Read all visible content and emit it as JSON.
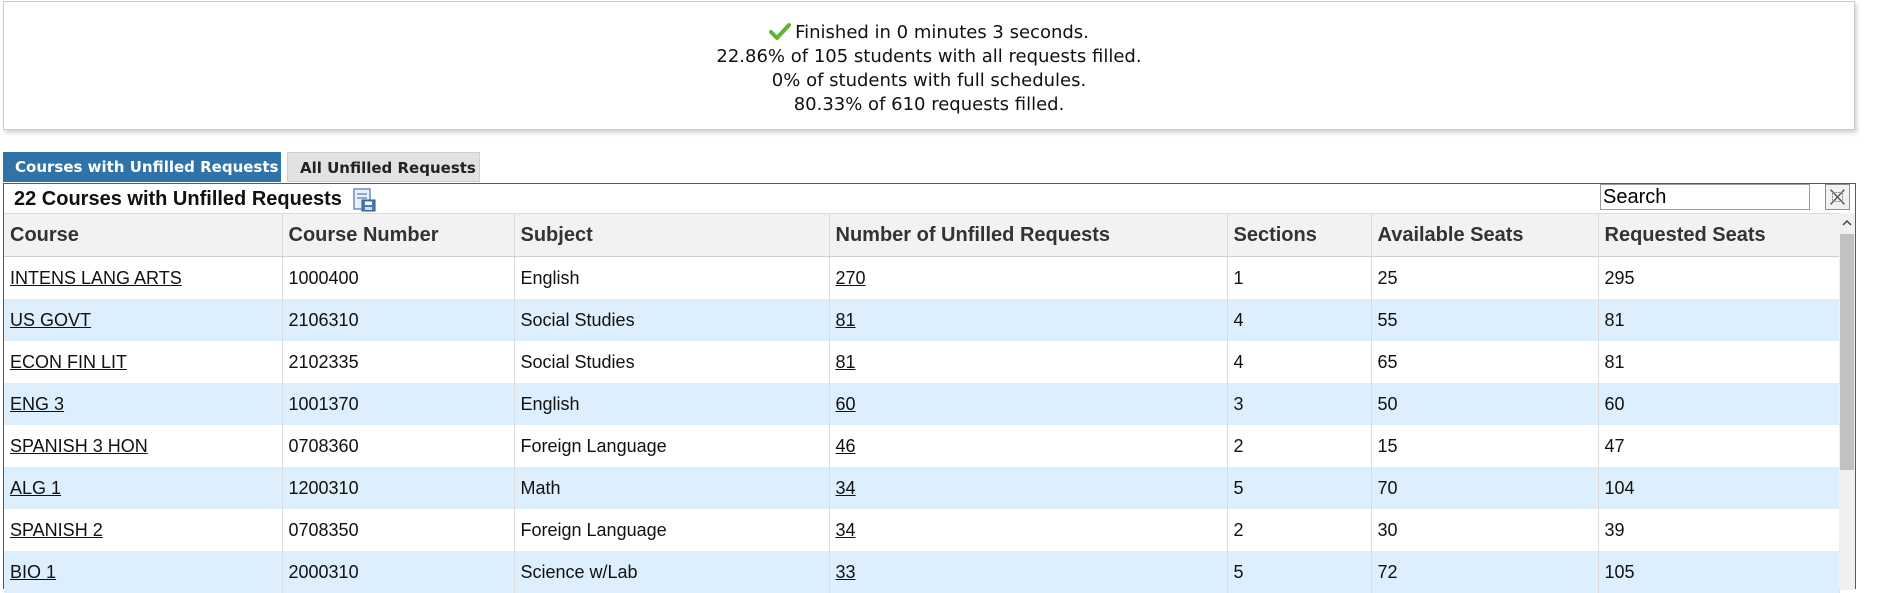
{
  "summary": {
    "finished": "Finished in 0 minutes 3 seconds.",
    "students_filled": "22.86% of 105 students with all requests filled.",
    "full_schedules": "0% of students with full schedules.",
    "requests_filled": "80.33% of 610 requests filled."
  },
  "tabs": {
    "active": "Courses with Unfilled Requests",
    "inactive": "All Unfilled Requests"
  },
  "panel": {
    "title": "22 Courses with Unfilled Requests",
    "search_placeholder": "Search"
  },
  "table": {
    "columns": [
      "Course",
      "Course Number",
      "Subject",
      "Number of Unfilled Requests",
      "Sections",
      "Available Seats",
      "Requested Seats"
    ],
    "rows": [
      [
        "INTENS LANG ARTS",
        "1000400",
        "English",
        "270",
        "1",
        "25",
        "295"
      ],
      [
        "US GOVT",
        "2106310",
        "Social Studies",
        "81",
        "4",
        "55",
        "81"
      ],
      [
        "ECON FIN LIT",
        "2102335",
        "Social Studies",
        "81",
        "4",
        "65",
        "81"
      ],
      [
        "ENG 3",
        "1001370",
        "English",
        "60",
        "3",
        "50",
        "60"
      ],
      [
        "SPANISH 3 HON",
        "0708360",
        "Foreign Language",
        "46",
        "2",
        "15",
        "47"
      ],
      [
        "ALG 1",
        "1200310",
        "Math",
        "34",
        "5",
        "70",
        "104"
      ],
      [
        "SPANISH 2",
        "0708350",
        "Foreign Language",
        "34",
        "2",
        "30",
        "39"
      ],
      [
        "BIO 1",
        "2000310",
        "Science w/Lab",
        "33",
        "5",
        "72",
        "105"
      ]
    ]
  },
  "colors": {
    "tab_active": "#2f73a9",
    "row_alt": "#ddeefc",
    "panel_border": "#d9202b",
    "check": "#5cb82e"
  },
  "icons": {
    "summary": "check-icon",
    "export": "export-icon",
    "clear": "clear-search-icon",
    "scroll": "scroll-up-arrow-icon"
  }
}
